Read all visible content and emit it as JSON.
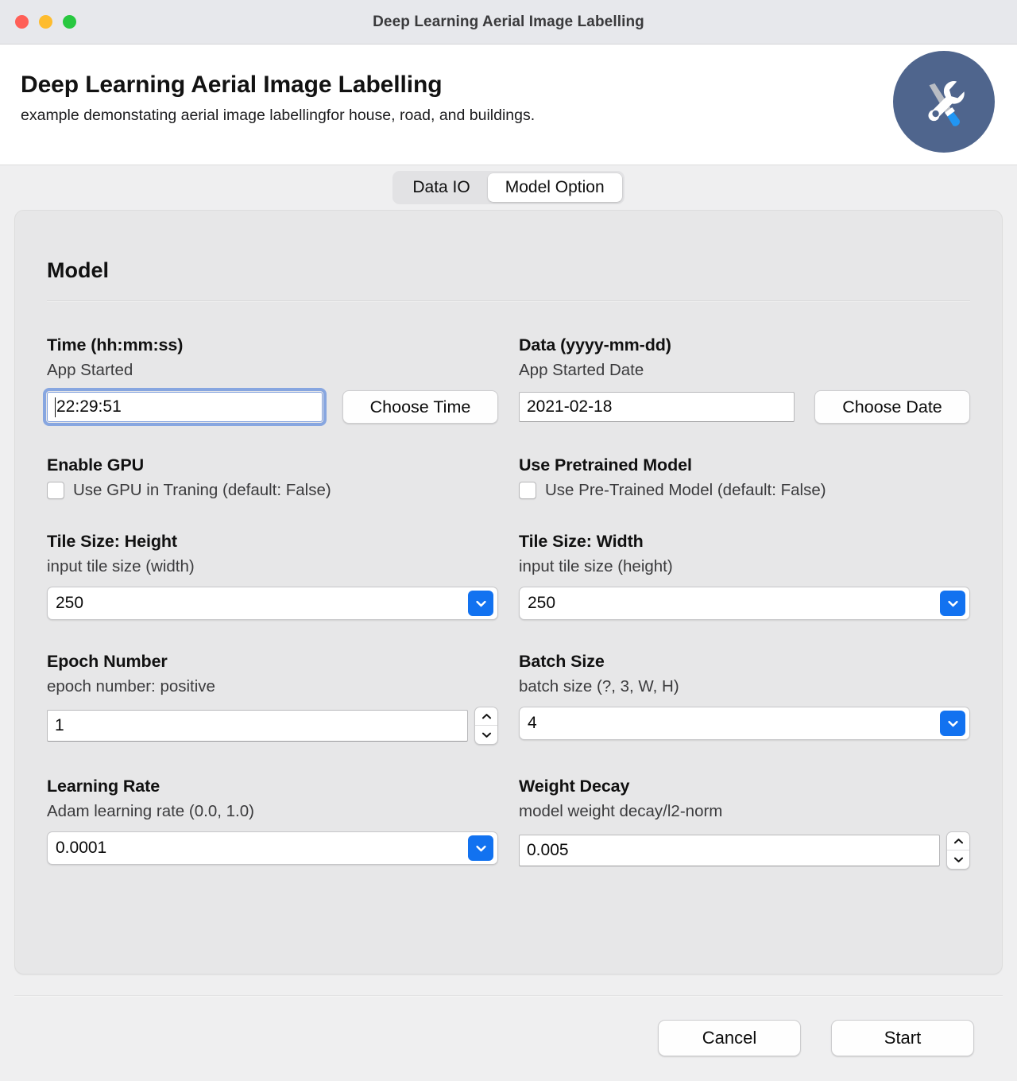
{
  "window": {
    "title": "Deep Learning Aerial Image Labelling",
    "traffic_lights": [
      "close-button",
      "minimize-button",
      "zoom-button"
    ]
  },
  "header": {
    "title": "Deep Learning Aerial Image Labelling",
    "subtitle": "example demonstating aerial image labellingfor house, road, and buildings.",
    "icon": "tools-icon",
    "icon_bg": "#4f658d"
  },
  "tabs": [
    {
      "label": "Data IO",
      "active": false
    },
    {
      "label": "Model Option",
      "active": true
    }
  ],
  "section": {
    "title": "Model"
  },
  "fields": {
    "time": {
      "label": "Time (hh:mm:ss)",
      "hint": "App Started",
      "value": "22:29:51",
      "focused": true,
      "button": "Choose Time"
    },
    "date": {
      "label": "Data (yyyy-mm-dd)",
      "hint": "App Started Date",
      "value": "2021-02-18",
      "focused": false,
      "button": "Choose Date"
    },
    "gpu": {
      "label": "Enable GPU",
      "checkbox_label": "Use GPU in Traning (default: False)",
      "checked": false
    },
    "pretrained": {
      "label": "Use Pretrained Model",
      "checkbox_label": "Use Pre-Trained Model (default: False)",
      "checked": false
    },
    "tile_height": {
      "label": "Tile Size: Height",
      "hint": "input tile size (width)",
      "value": "250",
      "control": "combobox"
    },
    "tile_width": {
      "label": "Tile Size: Width",
      "hint": "input tile size (height)",
      "value": "250",
      "control": "combobox"
    },
    "epoch": {
      "label": "Epoch Number",
      "hint": "epoch number: positive",
      "value": "1",
      "control": "spinner"
    },
    "batch": {
      "label": "Batch Size",
      "hint": "batch size (?, 3, W, H)",
      "value": "4",
      "control": "combobox"
    },
    "learning_rate": {
      "label": "Learning Rate",
      "hint": "Adam learning rate (0.0, 1.0)",
      "value": "0.0001",
      "control": "combobox"
    },
    "weight_decay": {
      "label": "Weight Decay",
      "hint": "model weight decay/l2-norm",
      "value": "0.005",
      "control": "spinner"
    }
  },
  "footer": {
    "cancel_label": "Cancel",
    "start_label": "Start"
  },
  "colors": {
    "accent_blue": "#1272f0",
    "focus_ring": "#87a6e0",
    "icon_circle": "#4f658d",
    "panel_bg": "#e7e7e8",
    "window_bg": "#efeff0"
  }
}
